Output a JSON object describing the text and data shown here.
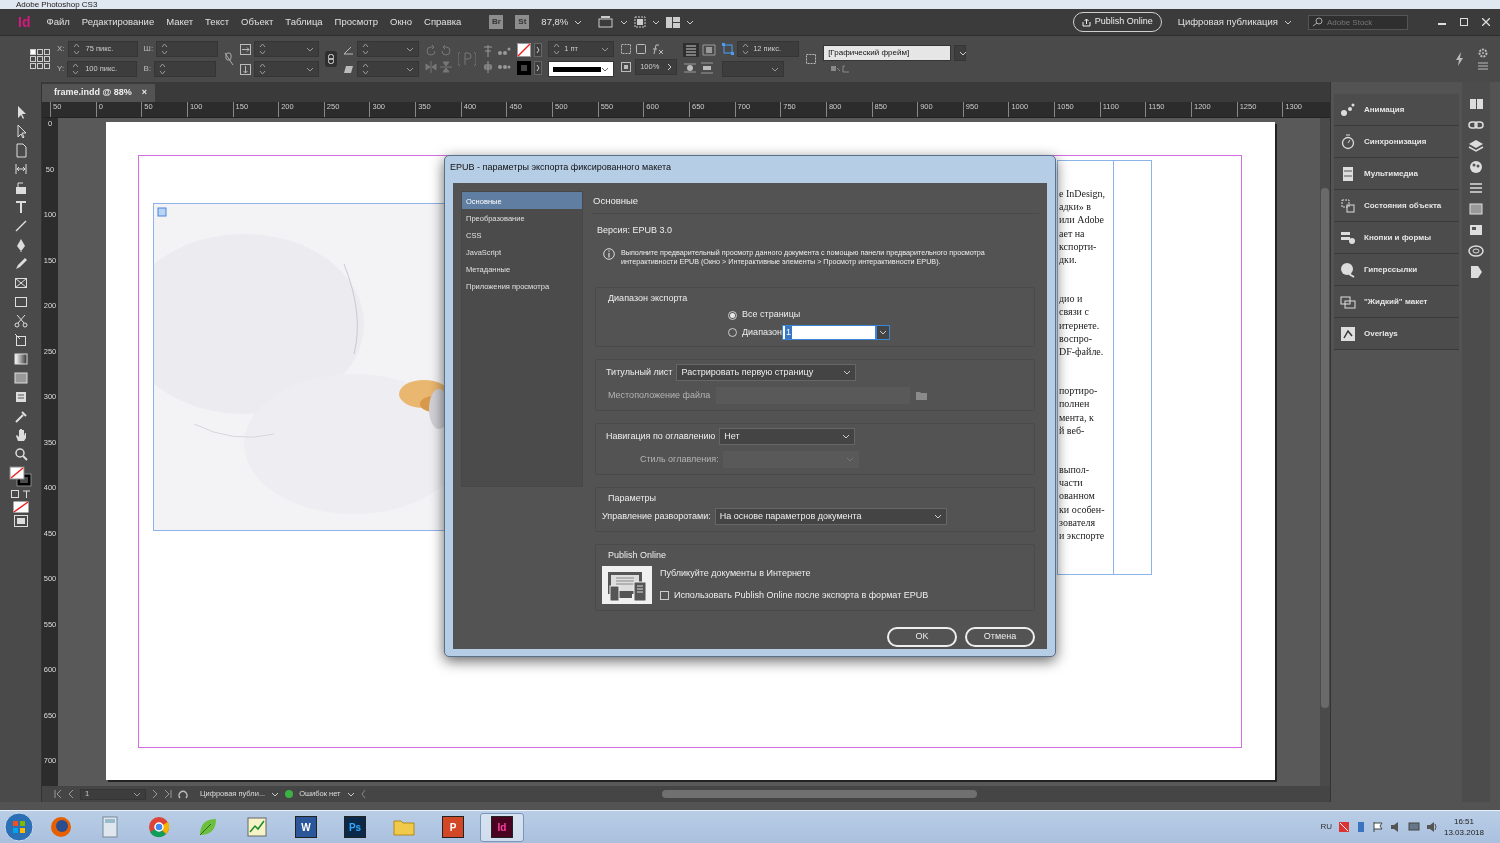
{
  "background_window": {
    "title": "Adobe Photoshop CS3"
  },
  "menu_bar": {
    "logo": "Id",
    "items": [
      "Файл",
      "Редактирование",
      "Макет",
      "Текст",
      "Объект",
      "Таблица",
      "Просмотр",
      "Окно",
      "Справка"
    ],
    "bridge": "Br",
    "stock": "St",
    "zoom": "87,8%",
    "publish_button": "Publish Online",
    "workspace": "Цифровая публикация",
    "search": {
      "placeholder": "Adobe Stock"
    }
  },
  "control_panel": {
    "x_label": "X:",
    "x_value": "75 пикс.",
    "y_label": "Y:",
    "y_value": "100 пикс.",
    "w_label": "Ш:",
    "h_label": "В:",
    "stroke_weight": "1 пт",
    "opacity": "100%",
    "gap": "12 пикс.",
    "object_style": "[Графический фрейм]"
  },
  "document_tab": {
    "title": "frame.indd @ 88%",
    "close": "×"
  },
  "ruler": {
    "h_labels": [
      "50",
      "0",
      "50",
      "100",
      "150",
      "200",
      "250",
      "300",
      "350",
      "400",
      "450",
      "500",
      "550",
      "600",
      "650",
      "700",
      "750",
      "800",
      "850",
      "900",
      "950",
      "1000",
      "1050",
      "1100",
      "1150",
      "1200",
      "1250",
      "1300"
    ],
    "v_labels": [
      "0",
      "50",
      "100",
      "150",
      "200",
      "250",
      "300",
      "350",
      "400",
      "450",
      "500",
      "550",
      "600",
      "650",
      "700"
    ]
  },
  "page": {
    "text_paragraphs": [
      [
        "е InDesign,",
        "адки» в",
        "или Adobe",
        "ает на",
        "кспорти-",
        "дки."
      ],
      [
        "дио и",
        "связи с",
        "итернете.",
        "воспро-",
        "DF-файле."
      ],
      [
        "портиро-",
        "полнен",
        "мента, к",
        "й веб-"
      ],
      [
        "выпол-",
        "части",
        "ованном",
        "ки особен-",
        "зователя",
        "и экспорте"
      ]
    ]
  },
  "status_bar": {
    "page": "1",
    "preflight_profile": "Цифровая публи...",
    "errors": "Ошибок нет"
  },
  "panels": [
    {
      "kind": "animation",
      "label": "Анимация"
    },
    {
      "kind": "timing",
      "label": "Синхронизация"
    },
    {
      "kind": "media",
      "label": "Мультимедиа"
    },
    {
      "kind": "states",
      "label": "Состояния объекта"
    },
    {
      "kind": "buttons",
      "label": "Кнопки и формы"
    },
    {
      "kind": "links",
      "label": "Гиперссылки"
    },
    {
      "kind": "liquid",
      "label": "\"Жидкий\" макет"
    },
    {
      "kind": "overlays",
      "label": "Overlays"
    }
  ],
  "dialog": {
    "title": "EPUB - параметры экспорта фиксированного макета",
    "categories": [
      {
        "label": "Основные",
        "selected": true
      },
      {
        "label": "Преобразование",
        "selected": false
      },
      {
        "label": "CSS",
        "selected": false
      },
      {
        "label": "JavaScript",
        "selected": false
      },
      {
        "label": "Метаданные",
        "selected": false
      },
      {
        "label": "Приложения просмотра",
        "selected": false
      }
    ],
    "heading": "Основные",
    "version": "Версия: EPUB 3.0",
    "info": "Выполните предварительный просмотр данного документа с помощью панели предварительного просмотра интерактивности EPUB (Окно > Интерактивные элементы > Просмотр интерактивности EPUB).",
    "export_range": {
      "title": "Диапазон экспорта",
      "options": [
        {
          "label": "Все страницы",
          "selected": true
        },
        {
          "label": "Диапазон",
          "selected": false
        }
      ],
      "range_value": "1"
    },
    "cover": {
      "label": "Титульный лист",
      "value": "Растрировать первую страницу",
      "file_label": "Местоположение файла",
      "file_disabled": true
    },
    "toc": {
      "label": "Навигация по оглавлению",
      "value": "Нет",
      "style_label": "Стиль оглавления:",
      "style_disabled": true
    },
    "options": {
      "title": "Параметры",
      "spread_label": "Управление разворотами:",
      "spread_value": "На основе параметров документа"
    },
    "publish": {
      "title": "Publish Online",
      "text": "Публикуйте документы в Интернете",
      "checkbox": {
        "label": "Использовать Publish Online после экспорта в формат EPUB",
        "checked": false
      }
    },
    "buttons": [
      "OK",
      "Отмена"
    ]
  },
  "taskbar": {
    "apps": [
      {
        "kind": "firefox",
        "selected": false
      },
      {
        "kind": "calculator",
        "selected": false
      },
      {
        "kind": "chrome",
        "selected": false
      },
      {
        "kind": "leaf",
        "selected": false
      },
      {
        "kind": "chart",
        "selected": false
      },
      {
        "kind": "word",
        "label": "W",
        "selected": false
      },
      {
        "kind": "photoshop",
        "label": "Ps",
        "selected": false
      },
      {
        "kind": "explorer",
        "selected": false
      },
      {
        "kind": "powerpoint",
        "label": "P",
        "selected": false
      },
      {
        "kind": "indesign",
        "label": "Id",
        "selected": true
      }
    ],
    "language": "RU",
    "time": "16:51",
    "date": "13.03.2018"
  }
}
